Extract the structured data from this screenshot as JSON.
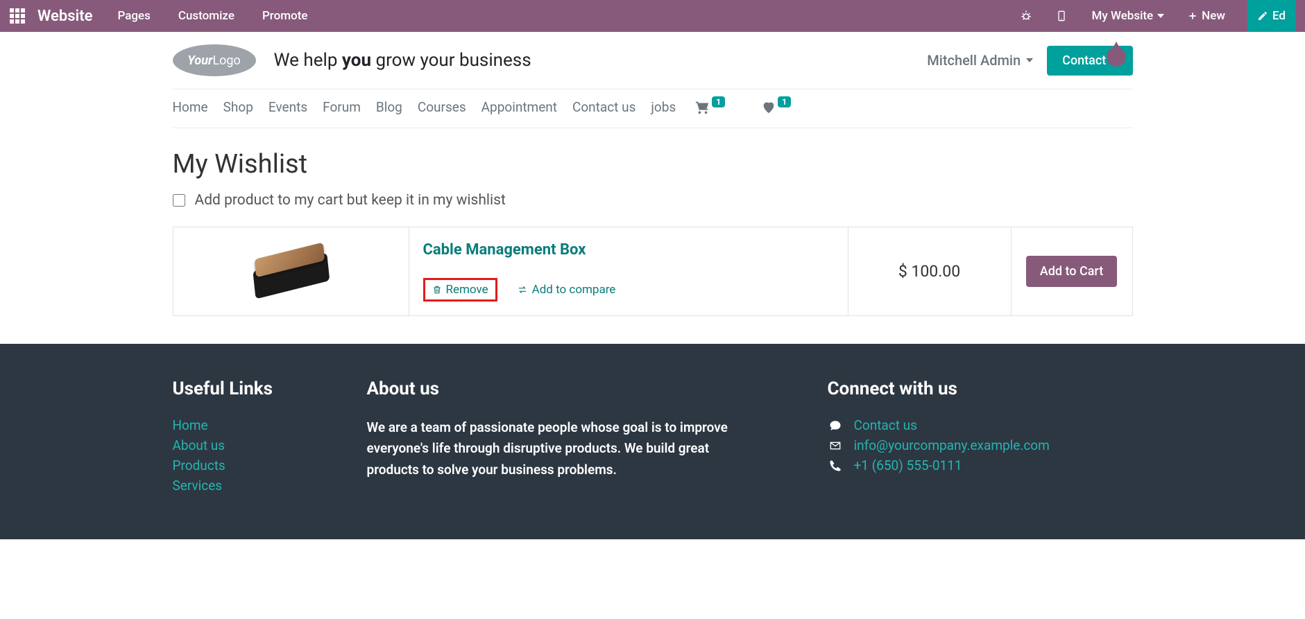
{
  "admin": {
    "brand": "Website",
    "menu": [
      "Pages",
      "Customize",
      "Promote"
    ],
    "my_website": "My Website",
    "new": "New",
    "edit": "Ed"
  },
  "header": {
    "logo_main": "Your",
    "logo_sub": "Logo",
    "tagline_pre": "We help ",
    "tagline_bold": "you",
    "tagline_post": " grow your business",
    "user_name": "Mitchell Admin",
    "contact_btn": "Contact U"
  },
  "nav": {
    "items": [
      "Home",
      "Shop",
      "Events",
      "Forum",
      "Blog",
      "Courses",
      "Appointment",
      "Contact us",
      "jobs"
    ],
    "cart_count": "1",
    "wishlist_count": "1"
  },
  "main": {
    "title": "My Wishlist",
    "keep_label": "Add product to my cart but keep it in my wishlist",
    "product": {
      "name": "Cable Management Box",
      "remove": "Remove",
      "compare": "Add to compare",
      "price": "$ 100.00",
      "add_cart": "Add to Cart"
    }
  },
  "footer": {
    "useful_title": "Useful Links",
    "useful_links": [
      "Home",
      "About us",
      "Products",
      "Services"
    ],
    "about_title": "About us",
    "about_text": "We are a team of passionate people whose goal is to improve everyone's life through disruptive products. We build great products to solve your business problems.",
    "connect_title": "Connect with us",
    "connect_contact": "Contact us",
    "connect_email": "info@yourcompany.example.com",
    "connect_phone": "+1 (650) 555-0111"
  }
}
